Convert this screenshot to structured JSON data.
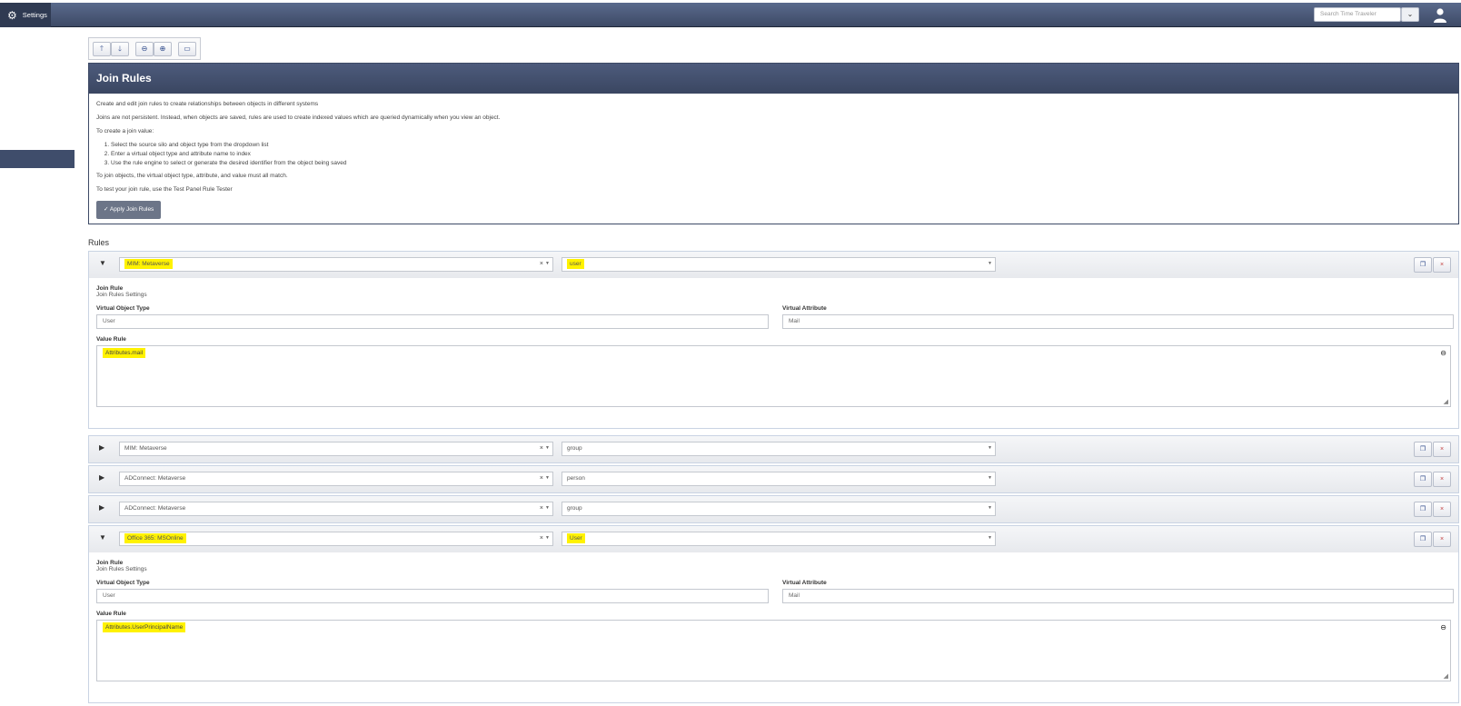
{
  "topbar": {
    "settings_label": "Settings",
    "search_placeholder": "Search Time Traveler"
  },
  "icons": {
    "gear": "gear-icon",
    "dropdown": "chevron-down-icon",
    "user": "user-icon",
    "arrow_up": "arrow-up-icon",
    "arrow_down": "arrow-down-icon",
    "collapse_all": "collapse-all-icon",
    "expand_all": "expand-all-icon",
    "save": "save-icon",
    "copy": "copy-icon",
    "delete": "close-icon"
  },
  "colors": {
    "header": "#3d4a66",
    "highlight": "#fff200",
    "apply_button": "#6c7588",
    "delete": "#c23b3b"
  },
  "panel": {
    "title": "Join Rules",
    "p1": "Create and edit join rules to create relationships between objects in different systems",
    "p2": "Joins are not persistent. Instead, when objects are saved, rules are used to create indexed values which are queried dynamically when you view an object.",
    "p3": "To create a join value:",
    "steps": [
      "Select the source silo and object type from the dropdown list",
      "Enter a virtual object type and attribute name to index",
      "Use the rule engine to select or generate the desired identifier from the object being saved"
    ],
    "p4": "To join objects, the virtual object type, attribute, and value must all match.",
    "p5": "To test your join rule, use the Test Panel Rule Tester",
    "apply_label": "✓ Apply Join Rules"
  },
  "rules_label": "Rules",
  "rules": [
    {
      "expanded": true,
      "toggle": "▼",
      "source": "MIM: Metaverse",
      "object_type": "user",
      "section_title": "Join Rule",
      "section_subtitle": "Join Rules Settings",
      "vot_label": "Virtual Object Type",
      "vot_value": "User",
      "va_label": "Virtual Attribute",
      "va_value": "Mail",
      "vr_label": "Value Rule",
      "vr_value": "Attributes.mail"
    },
    {
      "expanded": false,
      "toggle": "▶",
      "source": "MIM: Metaverse",
      "object_type": "group"
    },
    {
      "expanded": false,
      "toggle": "▶",
      "source": "ADConnect: Metaverse",
      "object_type": "person"
    },
    {
      "expanded": false,
      "toggle": "▶",
      "source": "ADConnect: Metaverse",
      "object_type": "group"
    },
    {
      "expanded": true,
      "toggle": "▼",
      "source": "Office 365: MSOnline",
      "object_type": "User",
      "section_title": "Join Rule",
      "section_subtitle": "Join Rules Settings",
      "vot_label": "Virtual Object Type",
      "vot_value": "User",
      "va_label": "Virtual Attribute",
      "va_value": "Mail",
      "vr_label": "Value Rule",
      "vr_value": "Attributes.UserPrincipalName"
    }
  ]
}
